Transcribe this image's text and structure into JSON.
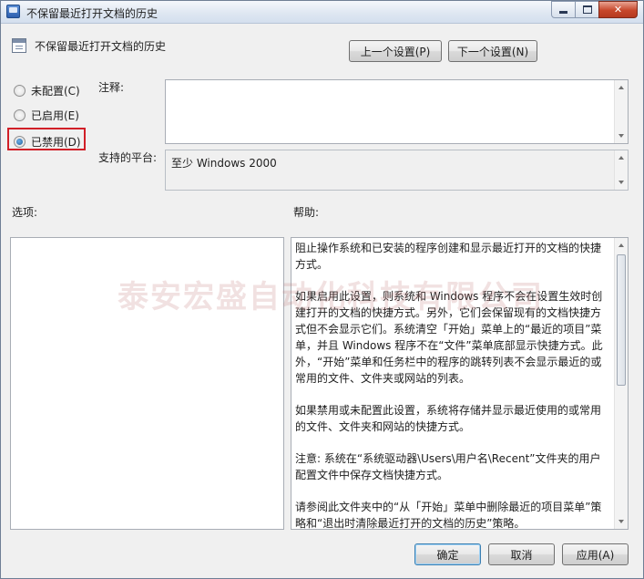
{
  "window": {
    "title": "不保留最近打开文档的历史"
  },
  "header": {
    "policy_title": "不保留最近打开文档的历史",
    "prev_label": "上一个设置(P)",
    "next_label": "下一个设置(N)"
  },
  "state": {
    "options": [
      {
        "label": "未配置(C)",
        "checked": false
      },
      {
        "label": "已启用(E)",
        "checked": false
      },
      {
        "label": "已禁用(D)",
        "checked": true
      }
    ]
  },
  "comment": {
    "label": "注释:",
    "value": ""
  },
  "platform": {
    "label": "支持的平台:",
    "value": "至少 Windows 2000"
  },
  "options_section": {
    "label": "选项:"
  },
  "help": {
    "label": "帮助:",
    "paragraphs": [
      "阻止操作系统和已安装的程序创建和显示最近打开的文档的快捷方式。",
      "如果启用此设置，则系统和 Windows 程序不会在设置生效时创建打开的文档的快捷方式。另外，它们会保留现有的文档快捷方式但不会显示它们。系统清空「开始」菜单上的“最近的项目”菜单，并且 Windows 程序不在“文件”菜单底部显示快捷方式。此外，“开始”菜单和任务栏中的程序的跳转列表不会显示最近的或常用的文件、文件夹或网站的列表。",
      "如果禁用或未配置此设置，系统将存储并显示最近使用的或常用的文件、文件夹和网站的快捷方式。",
      "注意: 系统在“系统驱动器\\Users\\用户名\\Recent”文件夹的用户配置文件中保存文档快捷方式。",
      "请参阅此文件夹中的“从「开始」菜单中删除最近的项目菜单”策略和“退出时清除最近打开的文档的历史”策略。"
    ]
  },
  "watermark": "泰安宏盛自动化科技有限公司",
  "footer": {
    "ok_label": "确定",
    "cancel_label": "取消",
    "apply_label": "应用(A)"
  }
}
